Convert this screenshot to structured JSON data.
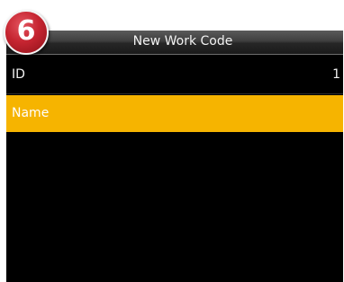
{
  "step_badge": {
    "number": "6",
    "color": "#c62531"
  },
  "header": {
    "title": "New Work Code"
  },
  "fields": [
    {
      "label": "ID",
      "value": "1",
      "selected": false
    },
    {
      "label": "Name",
      "value": "",
      "selected": true
    }
  ],
  "colors": {
    "selection": "#f6b400",
    "background": "#000000",
    "text": "#f2f2f2"
  }
}
